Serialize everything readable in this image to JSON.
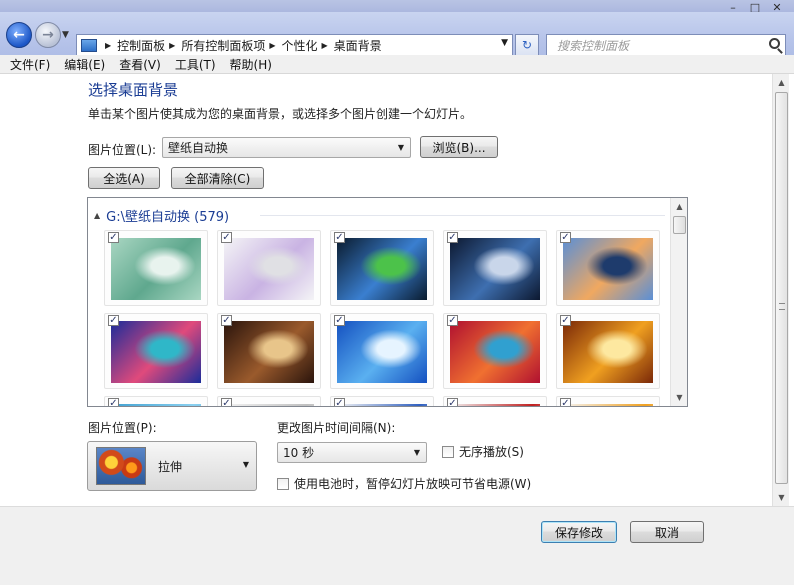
{
  "window": {
    "controls": [
      "–",
      "□",
      "✕"
    ]
  },
  "address_bar": {
    "breadcrumbs": [
      "控制面板",
      "所有控制面板项",
      "个性化",
      "桌面背景"
    ],
    "search_placeholder": "搜索控制面板"
  },
  "menu": [
    "文件(F)",
    "编辑(E)",
    "查看(V)",
    "工具(T)",
    "帮助(H)"
  ],
  "page": {
    "title": "选择桌面背景",
    "description": "单击某个图片使其成为您的桌面背景，或选择多个图片创建一个幻灯片。",
    "location_label": "图片位置(L):",
    "location_value": "壁纸自动换",
    "browse_label": "浏览(B)...",
    "select_all_label": "全选(A)",
    "clear_all_label": "全部清除(C)"
  },
  "gallery": {
    "group_title": "G:\\壁纸自动换 (579)",
    "rows": [
      [
        {
          "colors": [
            "#a9d6c2",
            "#5fa88e",
            "#e8f3ee"
          ],
          "checked": true
        },
        {
          "colors": [
            "#f4f4f6",
            "#c9b3e3",
            "#e0e0e4"
          ],
          "checked": true
        },
        {
          "colors": [
            "#0a1b2e",
            "#3a7fd0",
            "#4cc24a"
          ],
          "checked": true
        },
        {
          "colors": [
            "#0c1830",
            "#3e6fb0",
            "#c9d6ea"
          ],
          "checked": true
        },
        {
          "colors": [
            "#5a8fd6",
            "#f0a860",
            "#1e3b6c"
          ],
          "checked": true
        }
      ],
      [
        {
          "colors": [
            "#1b2c9a",
            "#e04a7c",
            "#2fb7c8"
          ],
          "checked": true
        },
        {
          "colors": [
            "#2a140c",
            "#9a5a2c",
            "#e8c58a"
          ],
          "checked": true
        },
        {
          "colors": [
            "#1450c0",
            "#5ab0f0",
            "#e6f4ff"
          ],
          "checked": true
        },
        {
          "colors": [
            "#b01030",
            "#f07030",
            "#30a0d0"
          ],
          "checked": true
        },
        {
          "colors": [
            "#7a2808",
            "#f0a020",
            "#fde8a0"
          ],
          "checked": true
        }
      ],
      [
        {
          "colors": [
            "#40a0d0",
            "#8ad0f0",
            "#e0f0f8"
          ],
          "checked": true
        },
        {
          "colors": [
            "#f2f2f2",
            "#c0c0c0",
            "#8080a0"
          ],
          "checked": true
        },
        {
          "colors": [
            "#f4f4f4",
            "#3060c0",
            "#d0d8f0"
          ],
          "checked": true
        },
        {
          "colors": [
            "#f0f0f0",
            "#c02020",
            "#909090"
          ],
          "checked": true
        },
        {
          "colors": [
            "#f4f4f4",
            "#f0a020",
            "#e0e0e0"
          ],
          "checked": true
        }
      ]
    ]
  },
  "bottom": {
    "position_label": "图片位置(P):",
    "position_value": "拉伸",
    "interval_label": "更改图片时间间隔(N):",
    "interval_value": "10 秒",
    "shuffle_label": "无序播放(S)",
    "battery_label": "使用电池时，暂停幻灯片放映可节省电源(W)"
  },
  "footer": {
    "save_label": "保存修改",
    "cancel_label": "取消"
  }
}
